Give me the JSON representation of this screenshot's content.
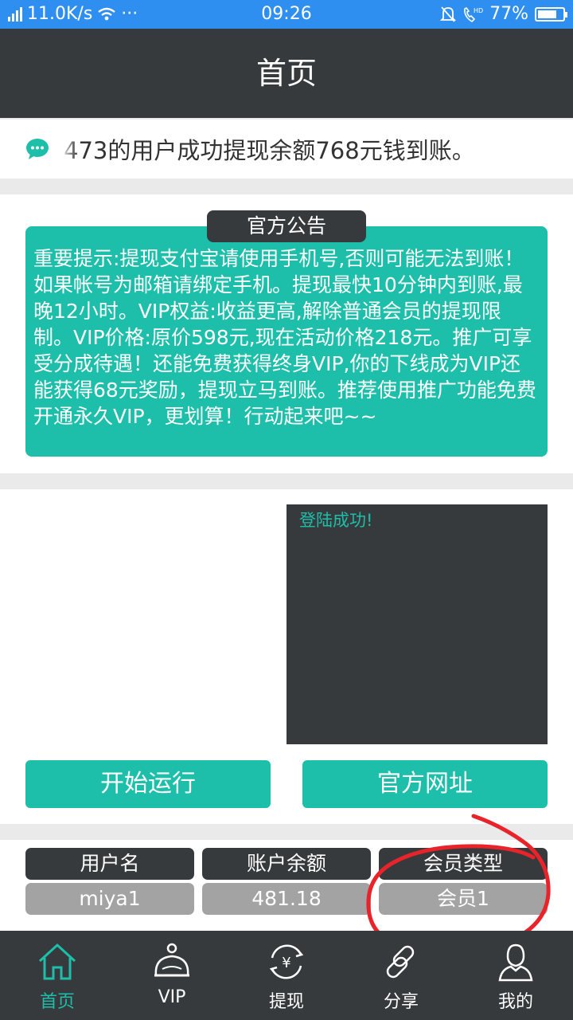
{
  "status_bar": {
    "signal_label": "4G",
    "net_speed": "11.0K/s",
    "more": "···",
    "time": "09:26",
    "hd": "HD",
    "battery": "77%",
    "battery_level": 0.77
  },
  "header": {
    "title": "首页"
  },
  "marquee": {
    "icon": "chat-bubble-icon",
    "text": "473的用户成功提现余额768元钱到账。"
  },
  "notice": {
    "title": "官方公告",
    "body": "重要提示:提现支付宝请使用手机号,否则可能无法到账！如果帐号为邮箱请绑定手机。提现最快10分钟内到账,最晚12小时。VIP权益:收益更高,解除普通会员的提现限制。VIP价格:原价598元,现在活动价格218元。推广可享受分成待遇！还能免费获得终身VIP,你的下线成为VIP还能获得68元奖励，提现立马到账。推荐使用推广功能免费开通永久VIP，更划算！行动起来吧~~"
  },
  "run": {
    "log_text": "登陆成功!",
    "start_label": "开始运行",
    "site_label": "官方网址"
  },
  "account": {
    "username_label": "用户名",
    "username": "miya1",
    "balance_label": "账户余额",
    "balance": "481.18",
    "member_type_label": "会员类型",
    "member_type": "会员1"
  },
  "tabs": [
    {
      "label": "首页",
      "icon": "home-icon",
      "active": true
    },
    {
      "label": "VIP",
      "icon": "crown-icon",
      "active": false
    },
    {
      "label": "提现",
      "icon": "yuan-exchange-icon",
      "active": false
    },
    {
      "label": "分享",
      "icon": "link-icon",
      "active": false
    },
    {
      "label": "我的",
      "icon": "user-icon",
      "active": false
    }
  ],
  "colors": {
    "status_bar": "#2f8ff0",
    "header": "#363a3c",
    "accent": "#1dbfaa",
    "value_pill": "#a3a3a3",
    "annotation": "#e8232a"
  }
}
